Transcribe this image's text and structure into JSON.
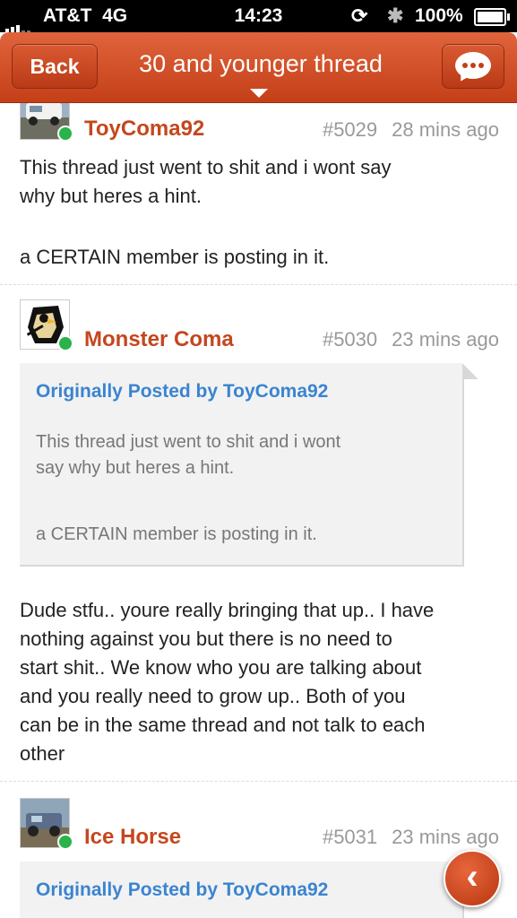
{
  "status_bar": {
    "carrier": "AT&T",
    "network": "4G",
    "time": "14:23",
    "battery": "100%",
    "icons": [
      "signal-icon",
      "rotation-lock-icon",
      "bluetooth-icon",
      "battery-icon"
    ]
  },
  "nav": {
    "back_label": "Back",
    "title": "30 and younger thread",
    "compose_icon": "chat-bubble-icon"
  },
  "posts": [
    {
      "username": "ToyComa92",
      "number": "#5029",
      "time": "28 mins ago",
      "online": true,
      "body_lines": [
        "This thread just went to shit and i wont say",
        "why but heres a hint.",
        "",
        "a CERTAIN member is posting in it."
      ]
    },
    {
      "username": "Monster Coma",
      "number": "#5030",
      "time": "23 mins ago",
      "online": true,
      "quote": {
        "header": "Originally Posted by ToyComa92",
        "lines": [
          "This thread just went to shit and i wont",
          "say why but heres a hint.",
          "",
          "a CERTAIN member is posting in it."
        ]
      },
      "body_lines": [
        "Dude stfu.. youre really bringing that up.. I have",
        "nothing against you but there is no need to",
        "start shit.. We know who you are talking about",
        "and you really need to grow up.. Both of you",
        "can be in the same thread and not talk to each",
        "other"
      ]
    },
    {
      "username": "Ice Horse",
      "number": "#5031",
      "time": "23 mins ago",
      "online": true,
      "quote": {
        "header": "Originally Posted by ToyComa92"
      }
    }
  ],
  "float_button": {
    "icon": "chevron-left-icon",
    "glyph": "‹"
  },
  "colors": {
    "accent": "#c9461c",
    "username": "#c4471e",
    "quote_header": "#3a84d0",
    "online": "#29b34a"
  }
}
